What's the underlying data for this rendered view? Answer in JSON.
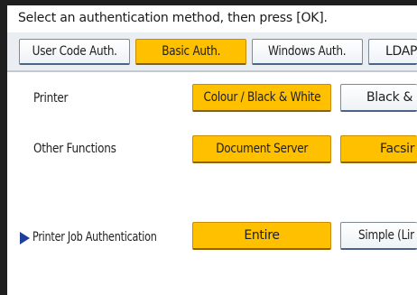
{
  "instruction": "Select an authentication method, then press [OK].",
  "tabs": [
    {
      "label": "User Code Auth.",
      "selected": false
    },
    {
      "label": "Basic Auth.",
      "selected": true
    },
    {
      "label": "Windows Auth.",
      "selected": false
    },
    {
      "label": "LDAP",
      "selected": false
    }
  ],
  "rows": {
    "printer": {
      "label": "Printer",
      "options": [
        {
          "label": "Colour / Black & White",
          "selected": true
        },
        {
          "label": "Black &",
          "selected": false
        }
      ]
    },
    "other_functions": {
      "label": "Other Functions",
      "options": [
        {
          "label": "Document Server",
          "selected": true
        },
        {
          "label": "Facsir",
          "selected": true
        }
      ]
    },
    "printer_job_auth": {
      "label": "Printer Job Authentication",
      "options": [
        {
          "label": "Entire",
          "selected": true
        },
        {
          "label": "Simple (Lir",
          "selected": false
        }
      ]
    }
  },
  "colors": {
    "selected": "#ffc000",
    "normal": "#f4f6f9",
    "arrow": "#1e3f9a"
  },
  "icons": {
    "row_pointer": "right-triangle-icon"
  }
}
